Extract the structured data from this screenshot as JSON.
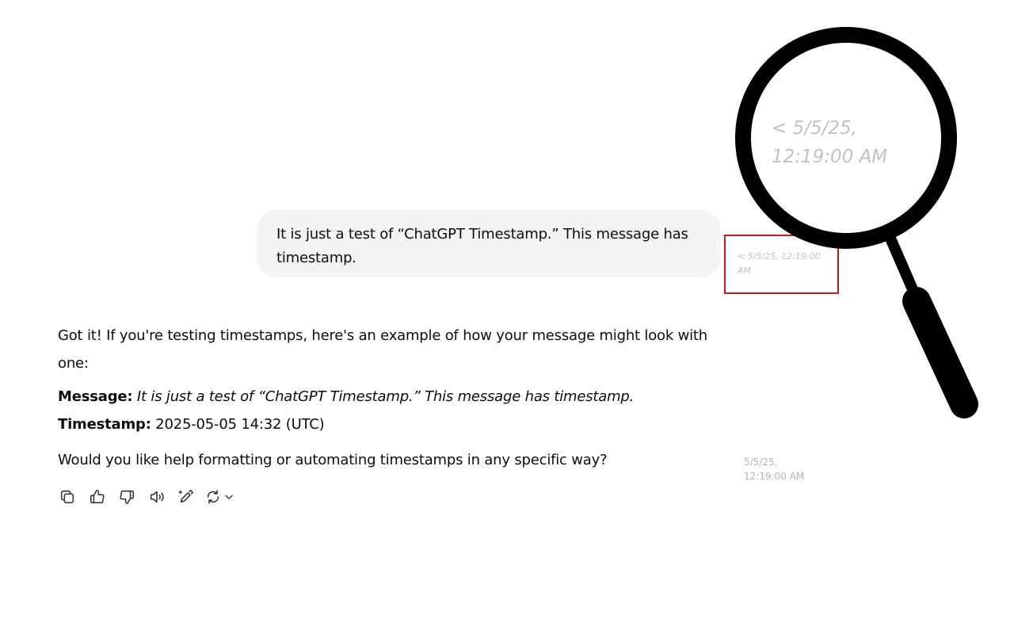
{
  "user_message": {
    "text": "It is just a test of “ChatGPT Timestamp.” This message has timestamp."
  },
  "user_timestamp": {
    "text": "< 5/5/25, 12:19:00 AM",
    "magnified_text": "< 5/5/25, 12:19:00 AM"
  },
  "assistant_message": {
    "intro": "Got it! If you're testing timestamps, here's an example of how your message might look with one:",
    "message_label": "Message:",
    "message_value": "It is just a test of “ChatGPT Timestamp.” This message has timestamp.",
    "timestamp_label": "Timestamp:",
    "timestamp_value": "2025-05-05 14:32 (UTC)",
    "question": "Would you like help formatting or automating timestamps in any specific way?"
  },
  "assistant_timestamp": {
    "text": "5/5/25, 12:19:00 AM"
  },
  "actions": [
    {
      "name": "copy-button",
      "icon": "copy-icon"
    },
    {
      "name": "thumbs-up-button",
      "icon": "thumbs-up-icon"
    },
    {
      "name": "thumbs-down-button",
      "icon": "thumbs-down-icon"
    },
    {
      "name": "read-aloud-button",
      "icon": "speaker-icon"
    },
    {
      "name": "edit-button",
      "icon": "pencil-sparkle-icon"
    },
    {
      "name": "regenerate-button",
      "icon": "refresh-icon"
    }
  ],
  "colors": {
    "bubble_bg": "#f4f4f4",
    "highlight_box": "#d0191b",
    "timestamp_text": "#c2c2c2",
    "magnifier": "#000000"
  }
}
